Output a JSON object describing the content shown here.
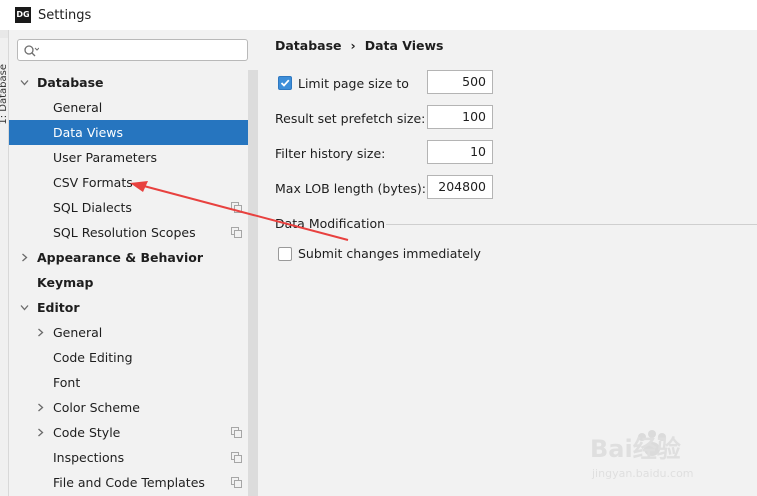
{
  "window": {
    "title": "Settings",
    "app_icon_text": "DG"
  },
  "ide_strip": {
    "vertical_label": "1: Database"
  },
  "search": {
    "placeholder": ""
  },
  "tree": {
    "items": [
      {
        "label": "Database",
        "level": 0,
        "bold": true,
        "expanded": true,
        "selected": false,
        "shared": false
      },
      {
        "label": "General",
        "level": 1,
        "bold": false,
        "selected": false,
        "shared": false
      },
      {
        "label": "Data Views",
        "level": 1,
        "bold": false,
        "selected": true,
        "shared": false
      },
      {
        "label": "User Parameters",
        "level": 1,
        "bold": false,
        "selected": false,
        "shared": false
      },
      {
        "label": "CSV Formats",
        "level": 1,
        "bold": false,
        "selected": false,
        "shared": false
      },
      {
        "label": "SQL Dialects",
        "level": 1,
        "bold": false,
        "selected": false,
        "shared": true
      },
      {
        "label": "SQL Resolution Scopes",
        "level": 1,
        "bold": false,
        "selected": false,
        "shared": true
      },
      {
        "label": "Appearance & Behavior",
        "level": 0,
        "bold": true,
        "expanded": false,
        "selected": false,
        "shared": false
      },
      {
        "label": "Keymap",
        "level": 0,
        "bold": true,
        "selected": false,
        "shared": false
      },
      {
        "label": "Editor",
        "level": 0,
        "bold": true,
        "expanded": true,
        "selected": false,
        "shared": false
      },
      {
        "label": "General",
        "level": 1,
        "bold": false,
        "expanded": false,
        "selected": false,
        "shared": false
      },
      {
        "label": "Code Editing",
        "level": 1,
        "bold": false,
        "selected": false,
        "shared": false
      },
      {
        "label": "Font",
        "level": 1,
        "bold": false,
        "selected": false,
        "shared": false
      },
      {
        "label": "Color Scheme",
        "level": 1,
        "bold": false,
        "expanded": false,
        "selected": false,
        "shared": false
      },
      {
        "label": "Code Style",
        "level": 1,
        "bold": false,
        "expanded": false,
        "selected": false,
        "shared": true
      },
      {
        "label": "Inspections",
        "level": 1,
        "bold": false,
        "selected": false,
        "shared": true
      },
      {
        "label": "File and Code Templates",
        "level": 1,
        "bold": false,
        "selected": false,
        "shared": true
      }
    ]
  },
  "breadcrumb": {
    "parent": "Database",
    "separator": "›",
    "current": "Data Views"
  },
  "form": {
    "limit_page_size": {
      "label": "Limit page size to",
      "checked": true,
      "value": "500"
    },
    "prefetch_size": {
      "label": "Result set prefetch size:",
      "value": "100"
    },
    "filter_history": {
      "label": "Filter history size:",
      "value": "10"
    },
    "max_lob": {
      "label": "Max LOB length (bytes):",
      "value": "204800"
    }
  },
  "data_modification": {
    "title": "Data Modification",
    "submit_immediately": {
      "label": "Submit changes immediately",
      "checked": false
    }
  },
  "watermark": {
    "text": "Bai经验",
    "subtext": "jingyan.baidu.com"
  },
  "colors": {
    "selection": "#2675bf",
    "checkbox_checked": "#3d8ed9",
    "annotation_arrow": "#e8413f",
    "pane_background": "#f2f2f2"
  }
}
